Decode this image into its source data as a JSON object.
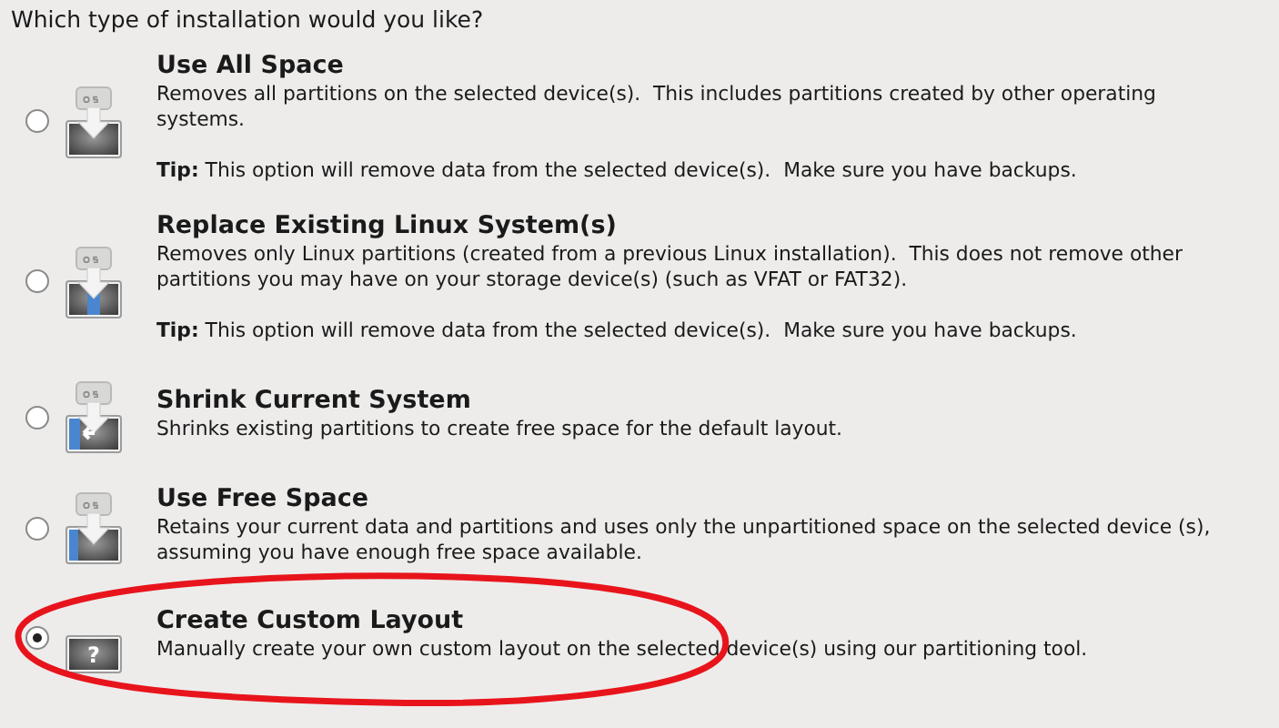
{
  "question": "Which type of installation would you like?",
  "options": [
    {
      "kind": "all",
      "title": "Use All Space",
      "description": "Removes all partitions on the selected device(s).  This includes partitions created by other operating systems.",
      "tip_label": "Tip:",
      "tip": "This option will remove data from the selected device(s).  Make sure you have backups.",
      "selected": false
    },
    {
      "kind": "replace",
      "title": "Replace Existing Linux System(s)",
      "description": "Removes only Linux partitions (created from a previous Linux installation).  This does not remove other partitions you may have on your storage device(s) (such as VFAT or FAT32).",
      "tip_label": "Tip:",
      "tip": "This option will remove data from the selected device(s).  Make sure you have backups.",
      "selected": false
    },
    {
      "kind": "shrink",
      "title": "Shrink Current System",
      "description": "Shrinks existing partitions to create free space for the default layout.",
      "selected": false
    },
    {
      "kind": "free",
      "title": "Use Free Space",
      "description": "Retains your current data and partitions and uses only the unpartitioned space on the selected device (s), assuming you have enough free space available.",
      "selected": false
    },
    {
      "kind": "custom",
      "icon_label": "?",
      "title": "Create Custom Layout",
      "description": "Manually create your own custom layout on the selected device(s) using our partitioning tool.",
      "selected": true
    }
  ],
  "annotation": {
    "kind": "ellipse",
    "color": "#e8141c"
  }
}
